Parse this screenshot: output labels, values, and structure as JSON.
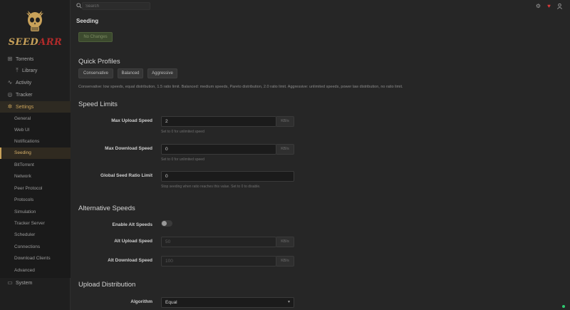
{
  "brand": {
    "name_part1": "SEED",
    "name_part2": "ARR",
    "gold": "#c9a25a",
    "red": "#b02a2a"
  },
  "search": {
    "placeholder": "Search"
  },
  "nav": {
    "torrents": "Torrents",
    "library": "Library",
    "activity": "Activity",
    "tracker": "Tracker",
    "settings": "Settings",
    "system": "System"
  },
  "settings_sections": [
    "General",
    "Web UI",
    "Notifications",
    "Seeding",
    "BitTorrent",
    "Network",
    "Peer Protocol",
    "Protocols",
    "Simulation",
    "Tracker Server",
    "Scheduler",
    "Connections",
    "Download Clients",
    "Advanced"
  ],
  "page": {
    "title": "Seeding",
    "no_changes": "No Changes"
  },
  "quick_profiles": {
    "title": "Quick Profiles",
    "buttons": [
      "Conservative",
      "Balanced",
      "Aggressive"
    ],
    "description": "Conservative: low speeds, equal distribution, 1.5 ratio limit. Balanced: medium speeds, Pareto distribution, 2.0 ratio limit. Aggressive: unlimited speeds, power law distribution, no ratio limit."
  },
  "speed_limits": {
    "title": "Speed Limits",
    "max_upload": {
      "label": "Max Upload Speed",
      "value": "2",
      "unit": "KB/s",
      "help": "Set to 0 for unlimited speed"
    },
    "max_download": {
      "label": "Max Download Speed",
      "value": "0",
      "unit": "KB/s",
      "help": "Set to 0 for unlimited speed"
    },
    "seed_ratio": {
      "label": "Global Seed Ratio Limit",
      "value": "0",
      "help": "Stop seeding when ratio reaches this value. Set to 0 to disable."
    }
  },
  "alt_speeds": {
    "title": "Alternative Speeds",
    "enable": {
      "label": "Enable Alt Speeds",
      "enabled": false
    },
    "alt_upload": {
      "label": "Alt Upload Speed",
      "value": "50",
      "unit": "KB/s"
    },
    "alt_download": {
      "label": "Alt Download Speed",
      "value": "100",
      "unit": "KB/s"
    }
  },
  "upload_distribution": {
    "title": "Upload Distribution",
    "algorithm": {
      "label": "Algorithm",
      "value": "Equal"
    }
  },
  "colors": {
    "status_online": "#2ecc71",
    "heart": "#d93a3a"
  }
}
